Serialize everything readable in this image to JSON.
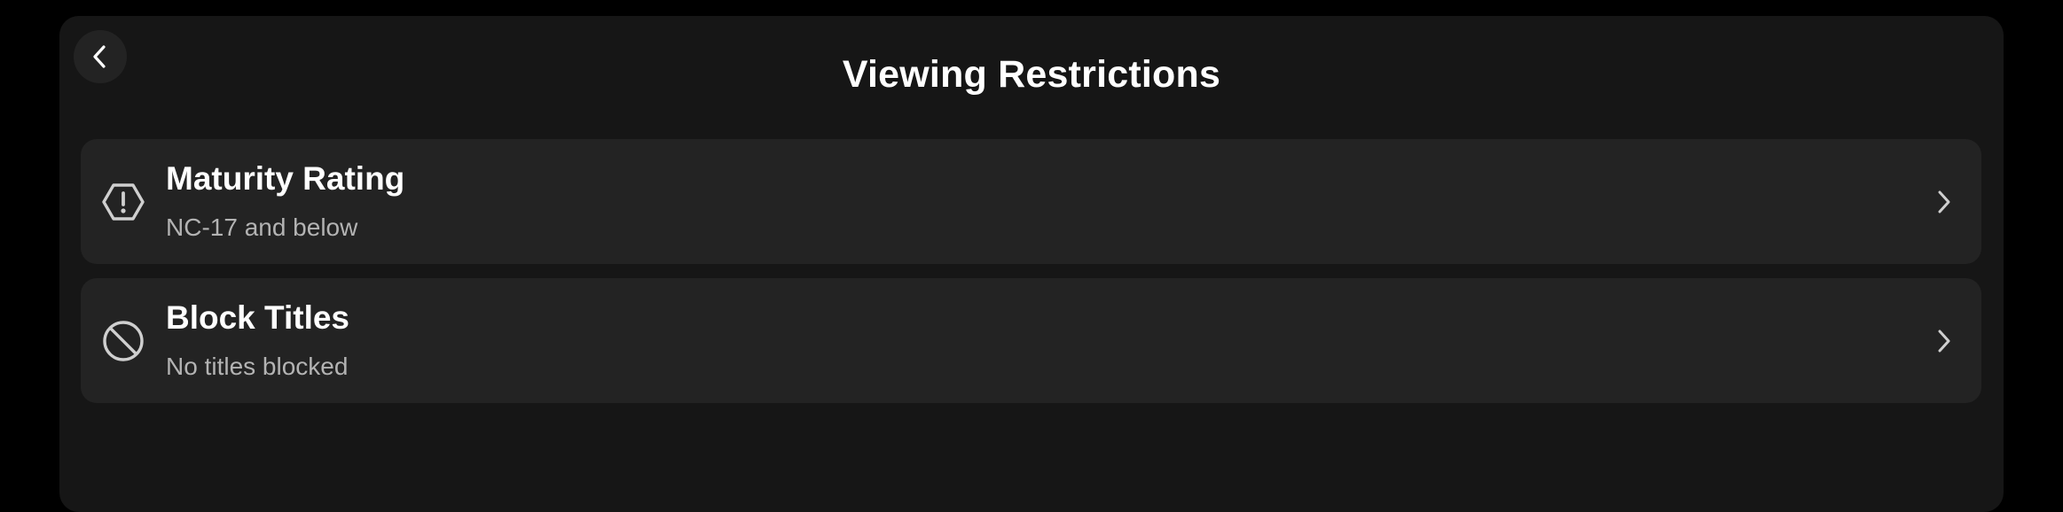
{
  "header": {
    "title": "Viewing Restrictions",
    "back_icon": "chevron-left-icon"
  },
  "restrictions": [
    {
      "title": "Maturity Rating",
      "subtitle": "NC-17 and below",
      "icon": "hexagon-exclamation-icon"
    },
    {
      "title": "Block Titles",
      "subtitle": "No titles blocked",
      "icon": "block-icon"
    }
  ],
  "colors": {
    "background": "#000000",
    "panel": "#161616",
    "row": "#232323",
    "text_primary": "#ffffff",
    "text_secondary": "#b3b3b3"
  }
}
